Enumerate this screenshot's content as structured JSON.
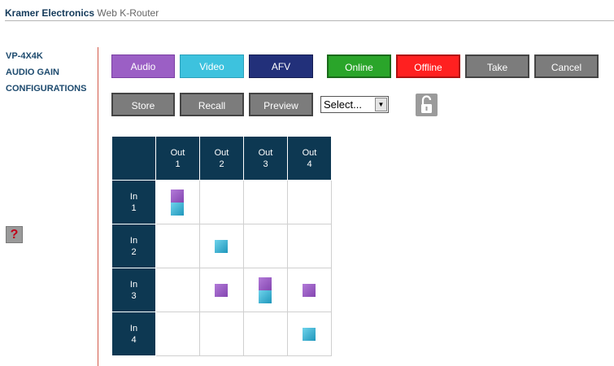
{
  "header": {
    "brand": "Kramer Electronics",
    "subtitle": "Web K-Router"
  },
  "sidebar": {
    "items": [
      {
        "label": "VP-4X4K"
      },
      {
        "label": "AUDIO GAIN"
      },
      {
        "label": "CONFIGURATIONS"
      }
    ],
    "help_label": "?"
  },
  "toolbar": {
    "audio": "Audio",
    "video": "Video",
    "afv": "AFV",
    "online": "Online",
    "offline": "Offline",
    "take": "Take",
    "cancel": "Cancel",
    "store": "Store",
    "recall": "Recall",
    "preview": "Preview"
  },
  "preset_select": {
    "selected": "Select..."
  },
  "colors": {
    "audio": "#9b5fc5",
    "video": "#3dc2de",
    "afv": "#22307a",
    "online": "#2aa52a",
    "offline": "#ff2020",
    "matrix_header": "#0d3852"
  },
  "matrix": {
    "outputs": [
      {
        "label": "Out",
        "num": "1"
      },
      {
        "label": "Out",
        "num": "2"
      },
      {
        "label": "Out",
        "num": "3"
      },
      {
        "label": "Out",
        "num": "4"
      }
    ],
    "inputs": [
      {
        "label": "In",
        "num": "1"
      },
      {
        "label": "In",
        "num": "2"
      },
      {
        "label": "In",
        "num": "3"
      },
      {
        "label": "In",
        "num": "4"
      }
    ],
    "routes": [
      [
        [
          "audio",
          "video"
        ],
        [],
        [],
        []
      ],
      [
        [],
        [
          "video"
        ],
        [],
        []
      ],
      [
        [],
        [
          "audio"
        ],
        [
          "audio",
          "video"
        ],
        [
          "audio"
        ]
      ],
      [
        [],
        [],
        [],
        [
          "video"
        ]
      ]
    ]
  }
}
